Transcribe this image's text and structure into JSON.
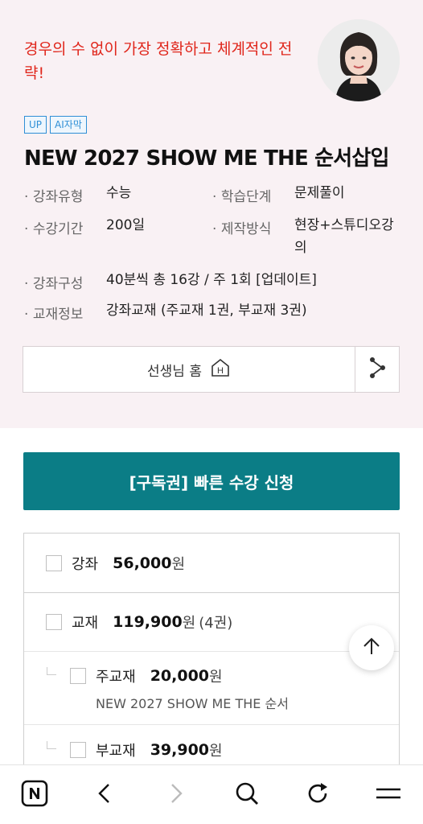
{
  "hero": {
    "slogan": "경우의 수 없이 가장 정확하고 체계적인 전략!",
    "badges": [
      "UP",
      "AI자막"
    ],
    "title": "NEW 2027 SHOW ME THE 순서삽입",
    "info": {
      "course_type_label": "강좌유형",
      "course_type_value": "수능",
      "level_label": "학습단계",
      "level_value": "문제풀이",
      "period_label": "수강기간",
      "period_value": "200일",
      "production_label": "제작방식",
      "production_value": "현장+스튜디오강의",
      "composition_label": "강좌구성",
      "composition_value": "40분씩 총 16강 / 주 1회 [업데이트]",
      "textbook_label": "교재정보",
      "textbook_value": "강좌교재 (주교재 1권, 부교재 3권)"
    },
    "home_button": "선생님 홈",
    "home_icon": "H"
  },
  "enroll_button": "[구독권] 빠른 수강 신청",
  "options": {
    "lecture": {
      "name": "강좌",
      "price": "56,000",
      "unit": "원"
    },
    "textbook": {
      "name": "교재",
      "price": "119,900",
      "unit": "원",
      "extra": "(4권)"
    },
    "main_book": {
      "name": "주교재",
      "price": "20,000",
      "unit": "원",
      "desc": "NEW 2027 SHOW ME THE 순서"
    },
    "sub_book": {
      "name": "부교재",
      "price": "39,900",
      "unit": "원"
    }
  },
  "colors": {
    "accent": "#0b7d86",
    "slogan": "#e0261b",
    "badge": "#2f8fd6",
    "hero_bg": "#f9f1f4"
  },
  "icons": [
    "share-icon",
    "home-icon",
    "arrow-up-icon",
    "naver-icon",
    "back-icon",
    "forward-icon",
    "search-icon",
    "refresh-icon",
    "menu-icon"
  ]
}
